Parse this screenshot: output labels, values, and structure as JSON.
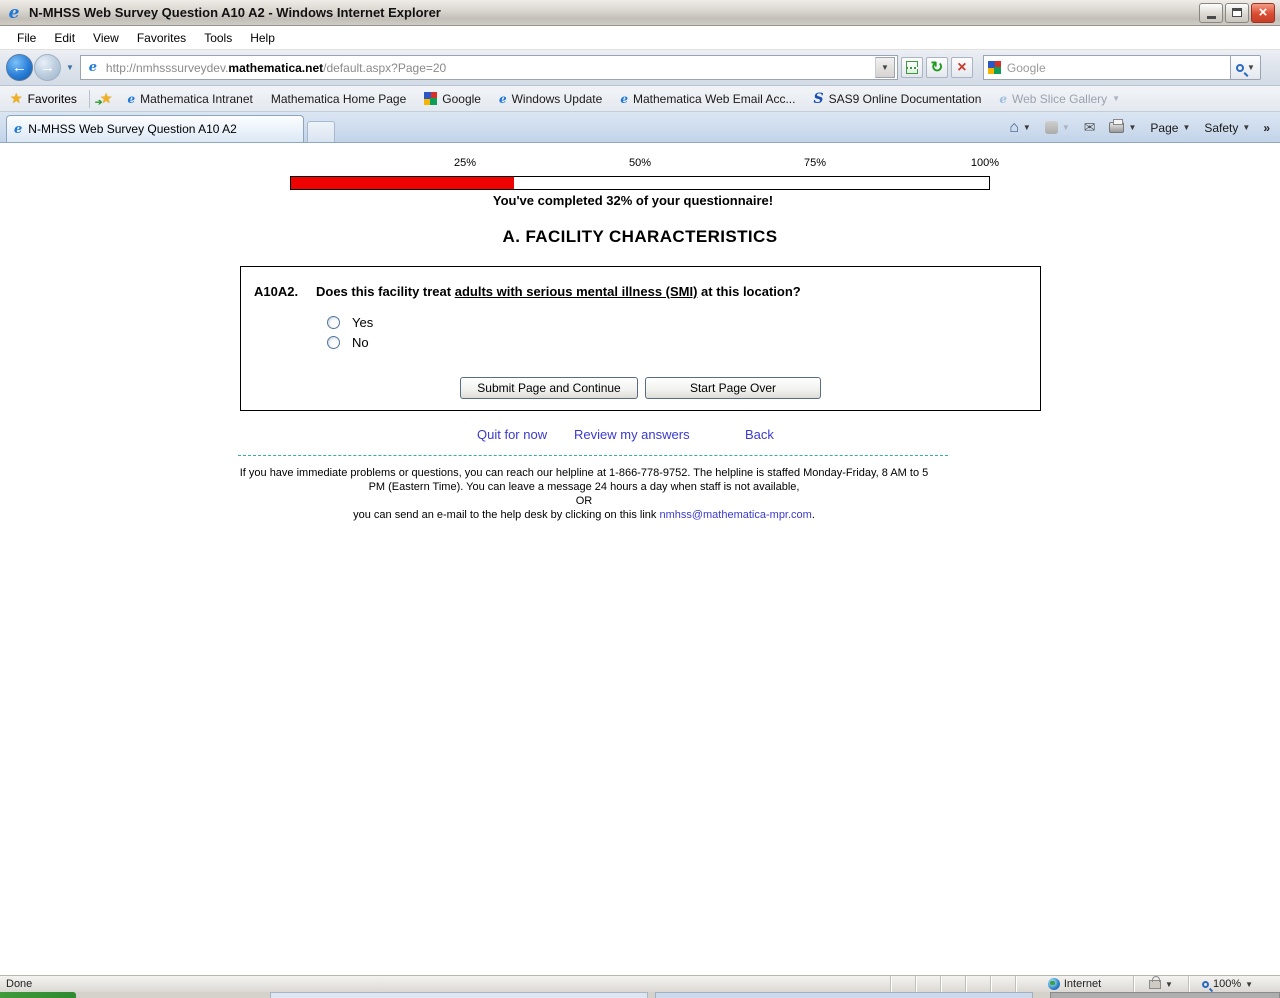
{
  "window": {
    "title": "N-MHSS Web Survey Question A10 A2 - Windows Internet Explorer"
  },
  "menu_bar": {
    "items": [
      {
        "label": "File"
      },
      {
        "label": "Edit"
      },
      {
        "label": "View"
      },
      {
        "label": "Favorites"
      },
      {
        "label": "Tools"
      },
      {
        "label": "Help"
      }
    ]
  },
  "nav_bar": {
    "url_prefix": "http://nmhsssurveydev.",
    "url_domain": "mathematica.net",
    "url_path": "/default.aspx?Page=20",
    "search_placeholder": "Google"
  },
  "favorites_bar": {
    "favorites_label": "Favorites",
    "links": [
      {
        "label": "Mathematica Intranet"
      },
      {
        "label": "Mathematica Home Page"
      },
      {
        "label": "Google"
      },
      {
        "label": "Windows Update"
      },
      {
        "label": "Mathematica Web Email Acc..."
      },
      {
        "label": "SAS9 Online Documentation"
      },
      {
        "label": "Web Slice Gallery"
      }
    ]
  },
  "tab_bar": {
    "active_tab": "N-MHSS Web Survey Question A10 A2",
    "page_label": "Page",
    "safety_label": "Safety",
    "more_chevron": "»"
  },
  "content": {
    "progress": {
      "labels": [
        "25%",
        "50%",
        "75%",
        "100%"
      ],
      "percent": 32,
      "message": "You've completed 32% of your questionnaire!"
    },
    "section_title": "A. FACILITY CHARACTERISTICS",
    "question": {
      "number": "A10A2.",
      "text_before": "Does this facility treat ",
      "text_underlined": "adults with serious mental illness (SMI)",
      "text_after": " at this location?",
      "options": [
        {
          "label": "Yes"
        },
        {
          "label": "No"
        }
      ]
    },
    "buttons": {
      "submit": "Submit Page and Continue",
      "start_over": "Start Page Over"
    },
    "links": {
      "quit": "Quit for now",
      "review": "Review my answers",
      "back": "Back"
    },
    "help": {
      "line1": "If you have immediate problems or questions, you can reach our helpline at 1-866-778-9752. The helpline is staffed Monday-Friday, 8 AM to 5",
      "line2": "PM (Eastern Time). You can leave a message 24 hours a day when staff is not available,",
      "or": "OR",
      "line3_before": "you can send an e-mail to the help desk by clicking on this link ",
      "email": "nmhss@mathematica-mpr.com",
      "line3_after": "."
    }
  },
  "status_bar": {
    "status": "Done",
    "zone": "Internet",
    "zoom": "100%"
  },
  "colors": {
    "progress_fill": "#ee0202",
    "link_blue": "#3a3acd",
    "dashed_separator": "#35b0a0"
  }
}
